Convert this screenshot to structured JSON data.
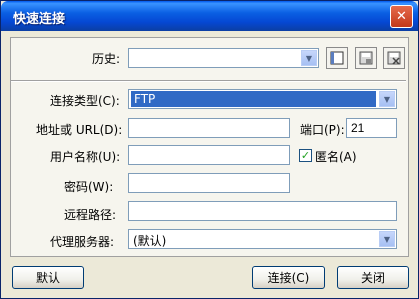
{
  "window": {
    "title": "快速连接",
    "close_glyph": "✕"
  },
  "history": {
    "label": "历史:",
    "value": ""
  },
  "connection_type": {
    "label": "连接类型(C):",
    "value": "FTP"
  },
  "address": {
    "label": "地址或 URL(D):",
    "value": ""
  },
  "port": {
    "label": "端口(P):",
    "value": "21"
  },
  "username": {
    "label": "用户名称(U):",
    "value": ""
  },
  "anonymous": {
    "label": "匿名(A)",
    "checked": true,
    "check_glyph": "✓"
  },
  "password": {
    "label": "密码(W):",
    "value": ""
  },
  "remote_path": {
    "label": "远程路径:",
    "value": ""
  },
  "proxy": {
    "label": "代理服务器:",
    "value": "(默认)"
  },
  "buttons": {
    "default": "默认",
    "connect": "连接(C)",
    "close": "关闭"
  },
  "icons": {
    "dropdown": "chevron-down-icon"
  },
  "colors": {
    "title_bar": "#0a5fe3",
    "selection": "#316ac5",
    "checkbox_check": "#21a121"
  }
}
